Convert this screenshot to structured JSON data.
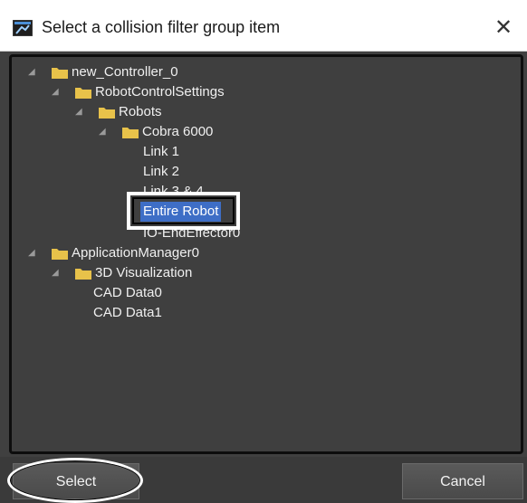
{
  "window": {
    "title": "Select a collision filter group item",
    "close_glyph": "✕",
    "icon": "app-window-icon"
  },
  "tree": {
    "items": [
      {
        "label": "new_Controller_0",
        "type": "folder",
        "expanded": true
      },
      {
        "label": "RobotControlSettings",
        "type": "folder",
        "expanded": true
      },
      {
        "label": "Robots",
        "type": "folder",
        "expanded": true
      },
      {
        "label": "Cobra 6000",
        "type": "folder",
        "expanded": true
      },
      {
        "label": "Link 1",
        "type": "leaf"
      },
      {
        "label": "Link 2",
        "type": "leaf"
      },
      {
        "label": "Link 3 & 4",
        "type": "leaf"
      },
      {
        "label": "Entire Robot",
        "type": "leaf",
        "selected": true
      },
      {
        "label": "IO-EndEffector0",
        "type": "leaf"
      },
      {
        "label": "ApplicationManager0",
        "type": "folder",
        "expanded": true
      },
      {
        "label": "3D Visualization",
        "type": "folder",
        "expanded": true
      },
      {
        "label": "CAD Data0",
        "type": "leaf"
      },
      {
        "label": "CAD Data1",
        "type": "leaf"
      }
    ]
  },
  "buttons": {
    "select_label": "Select",
    "cancel_label": "Cancel"
  },
  "colors": {
    "folder": "#e8c24a",
    "selection": "#3e6ec6",
    "panel_bg": "#3f3f3f",
    "text": "#f0f0f0"
  }
}
